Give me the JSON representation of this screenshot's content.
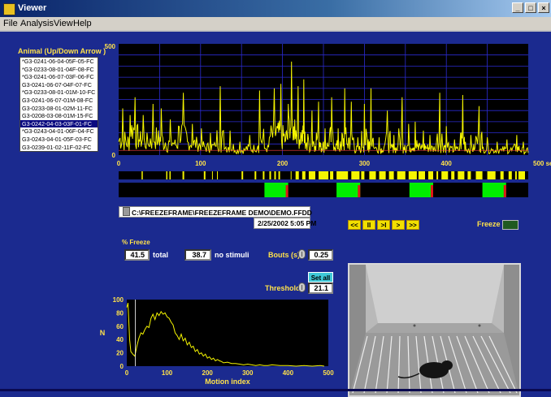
{
  "window": {
    "title": "Viewer",
    "min": "_",
    "max": "□",
    "close": "×"
  },
  "menu": [
    "File",
    "Analysis",
    "View",
    "Help"
  ],
  "animal_panel": {
    "label": "Animal  (Up/Down Arrow )",
    "items": [
      "*G3-0241-06-04-05F-05-FC",
      "*G3-0233-08-01-04F-08-FC",
      "*G3-0241-06-07-03F-06-FC",
      "G3-0241-06-07-04F-07-FC",
      "*G3-0233-08-01-01M-10-FC",
      "G3-0241-06-07-01M-08-FC",
      "G3-0233-08-01-02M-11-FC",
      "G3-0208-03-08-01M-15-FC",
      "G3-0242-04-03-03F-01-FC",
      "*G3-0243-04-01-06F-04-FC",
      "G3-0243-04-01-05F-03-FC",
      "G3-0239-01-02-11F-02-FC"
    ],
    "selected_index": 8
  },
  "file_path": "C:\\FREEZEFRAME\\FREEZEFRAME DEMO\\DEMO.FFDD",
  "datetime": "2/25/2002   5:05 PM",
  "freeze_pct": {
    "label": "% Freeze",
    "total_value": "41.5",
    "total_label": "total",
    "nostim_value": "38.7",
    "nostim_label": "no stimuli"
  },
  "bouts": {
    "label": "Bouts (s)",
    "value": "0.25"
  },
  "threshold": {
    "label": "Threshold",
    "value": "21.1",
    "set_all": "Set all"
  },
  "playback": {
    "buttons": [
      "<<",
      "II",
      ">I",
      ">",
      ">>"
    ],
    "freeze_label": "Freeze"
  },
  "colors": {
    "bg": "#1b2a8f",
    "trace": "#f5f500",
    "grid": "#2b2bd0",
    "label": "#ffe24a",
    "stim_green": "#00ee00",
    "stim_red": "#e01818"
  },
  "chart_data": [
    {
      "type": "line",
      "name": "motion-trace",
      "xlim": [
        0,
        500
      ],
      "ylim": [
        0,
        500
      ],
      "x_ticks": [
        "0",
        "100",
        "200",
        "300",
        "400",
        "500 sec"
      ],
      "y_ticks": [
        "0",
        "500"
      ],
      "threshold": 21.1,
      "peaks": [
        [
          0,
          60
        ],
        [
          5,
          210
        ],
        [
          10,
          40
        ],
        [
          14,
          180
        ],
        [
          20,
          260
        ],
        [
          25,
          70
        ],
        [
          30,
          180
        ],
        [
          37,
          40
        ],
        [
          42,
          230
        ],
        [
          48,
          60
        ],
        [
          52,
          210
        ],
        [
          58,
          30
        ],
        [
          63,
          160
        ],
        [
          68,
          50
        ],
        [
          73,
          130
        ],
        [
          79,
          280
        ],
        [
          84,
          60
        ],
        [
          90,
          140
        ],
        [
          96,
          50
        ],
        [
          101,
          120
        ],
        [
          106,
          30
        ],
        [
          112,
          100
        ],
        [
          118,
          40
        ],
        [
          124,
          310
        ],
        [
          130,
          30
        ],
        [
          136,
          110
        ],
        [
          142,
          20
        ],
        [
          148,
          60
        ],
        [
          154,
          20
        ],
        [
          160,
          90
        ],
        [
          166,
          20
        ],
        [
          172,
          290
        ],
        [
          178,
          30
        ],
        [
          184,
          80
        ],
        [
          190,
          300
        ],
        [
          194,
          120
        ],
        [
          198,
          320
        ],
        [
          203,
          60
        ],
        [
          207,
          230
        ],
        [
          211,
          420
        ],
        [
          215,
          160
        ],
        [
          219,
          310
        ],
        [
          223,
          80
        ],
        [
          226,
          340
        ],
        [
          230,
          20
        ],
        [
          236,
          200
        ],
        [
          240,
          40
        ],
        [
          244,
          240
        ],
        [
          248,
          30
        ],
        [
          252,
          120
        ],
        [
          256,
          40
        ],
        [
          260,
          260
        ],
        [
          264,
          30
        ],
        [
          268,
          120
        ],
        [
          272,
          20
        ],
        [
          276,
          300
        ],
        [
          280,
          30
        ],
        [
          284,
          240
        ],
        [
          288,
          20
        ],
        [
          292,
          80
        ],
        [
          296,
          20
        ],
        [
          300,
          230
        ],
        [
          304,
          20
        ],
        [
          308,
          300
        ],
        [
          312,
          30
        ],
        [
          318,
          80
        ],
        [
          322,
          20
        ],
        [
          328,
          200
        ],
        [
          332,
          30
        ],
        [
          336,
          90
        ],
        [
          340,
          20
        ],
        [
          346,
          260
        ],
        [
          350,
          20
        ],
        [
          354,
          140
        ],
        [
          358,
          30
        ],
        [
          362,
          150
        ],
        [
          366,
          20
        ],
        [
          372,
          110
        ],
        [
          376,
          30
        ],
        [
          380,
          90
        ],
        [
          386,
          20
        ],
        [
          392,
          280
        ],
        [
          396,
          30
        ],
        [
          400,
          130
        ],
        [
          404,
          20
        ],
        [
          410,
          70
        ],
        [
          416,
          20
        ],
        [
          420,
          270
        ],
        [
          424,
          20
        ],
        [
          430,
          90
        ],
        [
          434,
          20
        ],
        [
          440,
          220
        ],
        [
          444,
          30
        ],
        [
          450,
          80
        ],
        [
          456,
          20
        ],
        [
          462,
          60
        ],
        [
          468,
          20
        ],
        [
          474,
          70
        ],
        [
          480,
          20
        ],
        [
          486,
          90
        ],
        [
          490,
          20
        ],
        [
          494,
          60
        ],
        [
          500,
          10
        ]
      ]
    },
    {
      "type": "bar",
      "name": "freeze-raster",
      "xlim": [
        0,
        500
      ],
      "segments": [
        [
          28,
          29.5
        ],
        [
          58,
          59.5
        ],
        [
          62,
          63.5
        ],
        [
          78,
          80
        ],
        [
          104,
          106
        ],
        [
          114,
          115
        ],
        [
          120,
          121
        ],
        [
          150,
          152
        ],
        [
          166,
          168
        ],
        [
          176,
          178
        ],
        [
          184,
          186
        ],
        [
          190,
          192
        ],
        [
          195,
          197
        ],
        [
          210,
          211
        ],
        [
          216,
          220
        ],
        [
          224,
          228
        ],
        [
          232,
          240
        ],
        [
          244,
          256
        ],
        [
          258,
          262
        ],
        [
          266,
          280
        ],
        [
          284,
          294
        ],
        [
          296,
          300
        ],
        [
          306,
          314
        ],
        [
          318,
          326
        ],
        [
          330,
          336
        ],
        [
          340,
          350
        ],
        [
          354,
          364
        ],
        [
          366,
          374
        ],
        [
          378,
          384
        ],
        [
          388,
          390
        ],
        [
          394,
          402
        ],
        [
          406,
          410
        ],
        [
          414,
          422
        ],
        [
          426,
          430
        ],
        [
          436,
          444
        ],
        [
          450,
          460
        ],
        [
          466,
          470
        ],
        [
          476,
          480
        ],
        [
          484,
          486
        ],
        [
          488,
          496
        ]
      ]
    },
    {
      "type": "bar",
      "name": "stimulus-timeline",
      "xlim": [
        0,
        500
      ],
      "green": [
        [
          178,
          207
        ],
        [
          266,
          295
        ],
        [
          355,
          384
        ],
        [
          444,
          473
        ]
      ],
      "red": [
        [
          204,
          207
        ],
        [
          292,
          295
        ],
        [
          381,
          384
        ],
        [
          470,
          473
        ]
      ]
    },
    {
      "type": "line",
      "name": "motion-histogram",
      "xlabel": "Motion index",
      "ylabel": "N",
      "xlim": [
        0,
        500
      ],
      "ylim": [
        0,
        100
      ],
      "x_ticks": [
        "0",
        "100",
        "200",
        "300",
        "400",
        "500"
      ],
      "y_ticks": [
        "0",
        "20",
        "40",
        "60",
        "80",
        "100"
      ],
      "threshold": 21.1,
      "x": [
        0,
        3,
        7,
        10,
        15,
        20,
        25,
        30,
        35,
        40,
        45,
        50,
        55,
        60,
        65,
        70,
        75,
        80,
        85,
        90,
        95,
        100,
        105,
        110,
        115,
        120,
        125,
        130,
        135,
        140,
        145,
        150,
        155,
        160,
        165,
        170,
        175,
        180,
        185,
        190,
        195,
        200,
        205,
        210,
        215,
        220,
        225,
        230,
        235,
        240,
        250,
        260,
        270,
        280,
        290,
        300,
        310,
        320,
        330,
        340,
        350,
        360,
        380,
        400,
        420,
        440,
        460,
        480,
        490
      ],
      "y": [
        88,
        95,
        40,
        22,
        18,
        15,
        30,
        42,
        50,
        48,
        55,
        60,
        58,
        72,
        78,
        70,
        80,
        76,
        82,
        78,
        80,
        74,
        72,
        66,
        62,
        50,
        46,
        40,
        48,
        38,
        42,
        32,
        36,
        28,
        30,
        22,
        25,
        18,
        20,
        15,
        18,
        12,
        14,
        10,
        12,
        8,
        10,
        8,
        7,
        5,
        6,
        4,
        4,
        3,
        2,
        3,
        2,
        1,
        2,
        1,
        1,
        2,
        1,
        1,
        0,
        1,
        0,
        1,
        0
      ]
    }
  ]
}
